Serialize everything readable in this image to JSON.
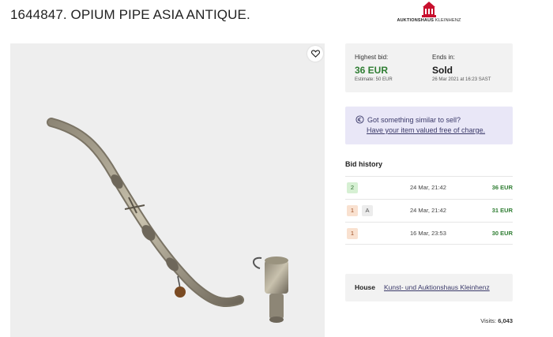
{
  "lot": {
    "title": "1644847. OPIUM PIPE ASIA ANTIQUE."
  },
  "logo": {
    "name_bold": "AUKTIONSHAUS",
    "name_light": "KLEINHENZ",
    "color": "#c8102e"
  },
  "bid": {
    "highest_label": "Highest bid:",
    "highest_value": "36 EUR",
    "estimate": "Estimate: 50 EUR",
    "ends_label": "Ends in:",
    "ends_value": "Sold",
    "ends_date": "26 Mar 2021 at 16:23 SAST"
  },
  "sell": {
    "question": "Got something similar to sell?",
    "link": "Have your item valued free of charge."
  },
  "bid_history": {
    "title": "Bid history",
    "rows": [
      {
        "bidder": "2",
        "tag": "",
        "date": "24 Mar, 21:42",
        "amount": "36 EUR",
        "badge_color": "green"
      },
      {
        "bidder": "1",
        "tag": "A",
        "date": "24 Mar, 21:42",
        "amount": "31 EUR",
        "badge_color": "orange"
      },
      {
        "bidder": "1",
        "tag": "",
        "date": "16 Mar, 23:53",
        "amount": "30 EUR",
        "badge_color": "orange"
      }
    ]
  },
  "house": {
    "label": "House",
    "name": "Kunst- und Auktionshaus Kleinhenz"
  },
  "visits": {
    "label": "Visits:",
    "value": "6,043"
  },
  "colors": {
    "accent_green": "#2e7d32",
    "sell_bg": "#e9e7f7",
    "panel_bg": "#f2f2f2"
  }
}
